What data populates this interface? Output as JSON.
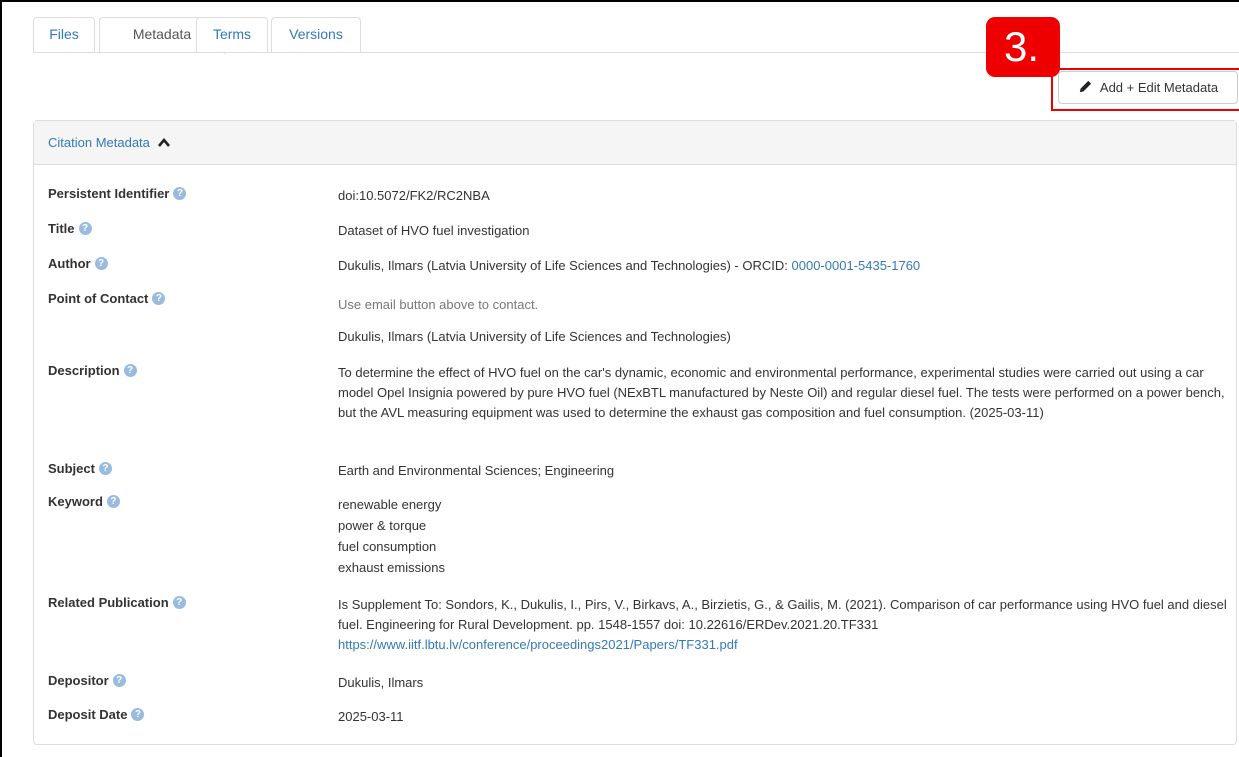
{
  "tabs": [
    {
      "label": "Files",
      "active": false
    },
    {
      "label": "Metadata",
      "active": true
    },
    {
      "label": "Terms",
      "active": false
    },
    {
      "label": "Versions",
      "active": false
    }
  ],
  "callout": {
    "label": "3.",
    "color": "#ee0000"
  },
  "edit_button": {
    "label": "Add + Edit Metadata",
    "icon": "pencil-icon"
  },
  "panel": {
    "title": "Citation Metadata",
    "icon": "chevron-up-icon"
  },
  "fields": {
    "persistent_identifier": {
      "label": "Persistent Identifier",
      "value": "doi:10.5072/FK2/RC2NBA"
    },
    "title": {
      "label": "Title",
      "value": "Dataset of HVO fuel investigation"
    },
    "author": {
      "label": "Author",
      "value": "Dukulis, Ilmars (Latvia University of Life Sciences and Technologies) - ORCID: ",
      "orcid": "0000-0001-5435-1760"
    },
    "point_of_contact": {
      "label": "Point of Contact",
      "note": "Use email button above to contact.",
      "value": "Dukulis, Ilmars (Latvia University of Life Sciences and Technologies)"
    },
    "description": {
      "label": "Description",
      "value": "To determine the effect of HVO fuel on the car's dynamic, economic and environmental performance, experimental studies were carried out using a car model Opel Insignia powered by pure HVO fuel (NExBTL manufactured by Neste Oil) and regular diesel fuel. The tests were performed on a power bench, but the AVL measuring equipment was used to determine the exhaust gas composition and fuel consumption. (2025-03-11)"
    },
    "subject": {
      "label": "Subject",
      "value": "Earth and Environmental Sciences; Engineering"
    },
    "keyword": {
      "label": "Keyword",
      "values": [
        "renewable energy",
        "power & torque",
        "fuel consumption",
        "exhaust emissions"
      ]
    },
    "related_publication": {
      "label": "Related Publication",
      "value": "Is Supplement To: Sondors, K., Dukulis, I., Pirs, V., Birkavs, A., Birzietis, G., & Gailis, M. (2021). Comparison of car performance using HVO fuel and diesel fuel. Engineering for Rural Development. pp. 1548-1557 doi: 10.22616/ERDev.2021.20.TF331",
      "link": "https://www.iitf.lbtu.lv/conference/proceedings2021/Papers/TF331.pdf"
    },
    "depositor": {
      "label": "Depositor",
      "value": "Dukulis, Ilmars"
    },
    "deposit_date": {
      "label": "Deposit Date",
      "value": "2025-03-11"
    }
  },
  "help_icon": "question-circle-icon"
}
